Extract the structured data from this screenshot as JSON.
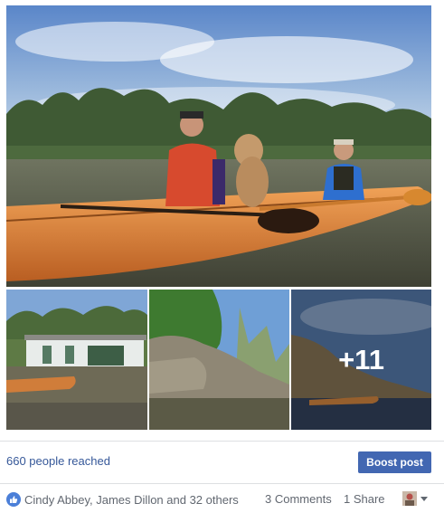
{
  "photos": {
    "main_alt_icon": "photo-kayak-dog",
    "more_count": "+11"
  },
  "reach": {
    "text": "660 people reached",
    "boost_label": "Boost post"
  },
  "reactions": {
    "names": "Cindy Abbey, James Dillon and 32 others",
    "comments": "3 Comments",
    "shares": "1 Share"
  },
  "colors": {
    "link": "#365899",
    "button": "#4267b2",
    "like": "#4b7fd8",
    "meta": "#616770"
  }
}
